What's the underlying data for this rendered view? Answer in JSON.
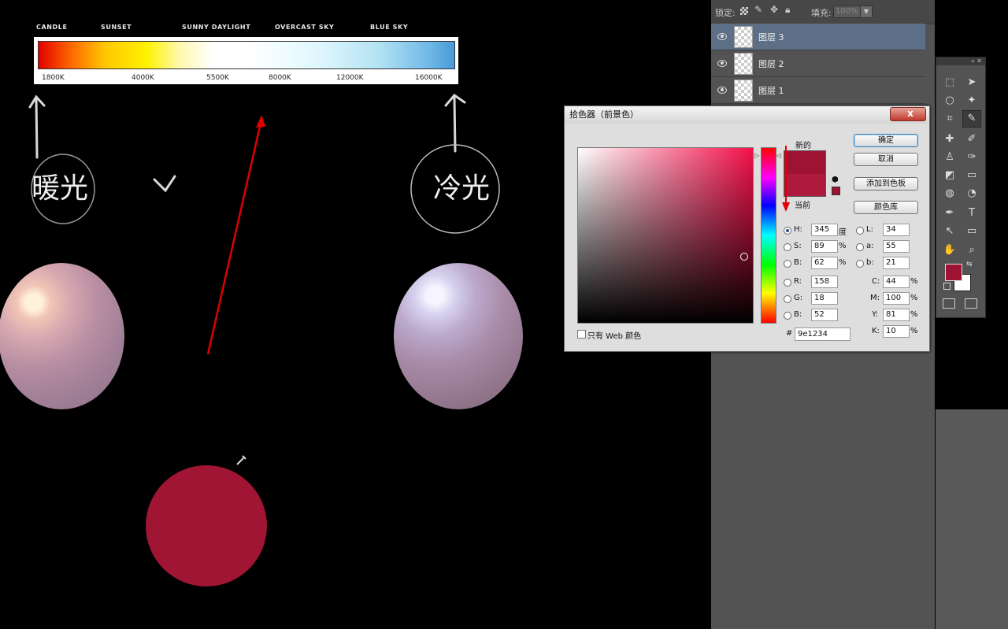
{
  "canvas": {
    "kelvin_labels": [
      "CANDLE",
      "SUNSET",
      "SUNNY DAYLIGHT",
      "OVERCAST SKY",
      "BLUE SKY"
    ],
    "kelvin_ticks": [
      "1800K",
      "4000K",
      "5500K",
      "8000K",
      "12000K",
      "16000K"
    ],
    "hand_left": "暖光",
    "hand_right": "冷光",
    "colors": {
      "red_arrow": "#e00000",
      "warm_sphere": "#b08aa0",
      "cool_sphere": "#a88ca8",
      "paint_blob": "#a01434"
    }
  },
  "layers": {
    "lock_label": "锁定:",
    "fill_label": "填充:",
    "fill_value": "100%",
    "items": [
      {
        "name": "图层 3",
        "selected": true
      },
      {
        "name": "图层 2",
        "selected": false
      },
      {
        "name": "图层 1",
        "selected": false
      }
    ]
  },
  "toolbox": {
    "tools": [
      "marquee-icon",
      "move-icon",
      "lasso-icon",
      "magic-wand-icon",
      "crop-icon",
      "eyedropper-icon",
      "healing-icon",
      "brush-icon",
      "stamp-icon",
      "history-brush-icon",
      "eraser-icon",
      "gradient-icon",
      "blur-icon",
      "dodge-icon",
      "pen-icon",
      "type-icon",
      "path-select-icon",
      "shape-icon",
      "hand-icon",
      "zoom-icon"
    ],
    "foreground": "#9e1234",
    "background": "#ffffff"
  },
  "picker": {
    "title": "拾色器（前景色）",
    "close": "x",
    "new_label": "新的",
    "current_label": "当前",
    "buttons": {
      "ok": "确定",
      "cancel": "取消",
      "add_swatch": "添加到色板",
      "libraries": "颜色库"
    },
    "fields": {
      "H": {
        "label": "H:",
        "value": "345",
        "unit": "度"
      },
      "S": {
        "label": "S:",
        "value": "89",
        "unit": "%"
      },
      "B": {
        "label": "B:",
        "value": "62",
        "unit": "%"
      },
      "R": {
        "label": "R:",
        "value": "158"
      },
      "G": {
        "label": "G:",
        "value": "18"
      },
      "Bl": {
        "label": "B:",
        "value": "52"
      },
      "L": {
        "label": "L:",
        "value": "34"
      },
      "a": {
        "label": "a:",
        "value": "55"
      },
      "b": {
        "label": "b:",
        "value": "21"
      },
      "C": {
        "label": "C:",
        "value": "44",
        "unit": "%"
      },
      "M": {
        "label": "M:",
        "value": "100",
        "unit": "%"
      },
      "Y": {
        "label": "Y:",
        "value": "81",
        "unit": "%"
      },
      "K": {
        "label": "K:",
        "value": "10",
        "unit": "%"
      }
    },
    "web_only": "只有 Web 颜色",
    "hex_label": "#",
    "hex_value": "9e1234",
    "new_color": "#9e1234",
    "current_color": "#ad1a3e"
  }
}
